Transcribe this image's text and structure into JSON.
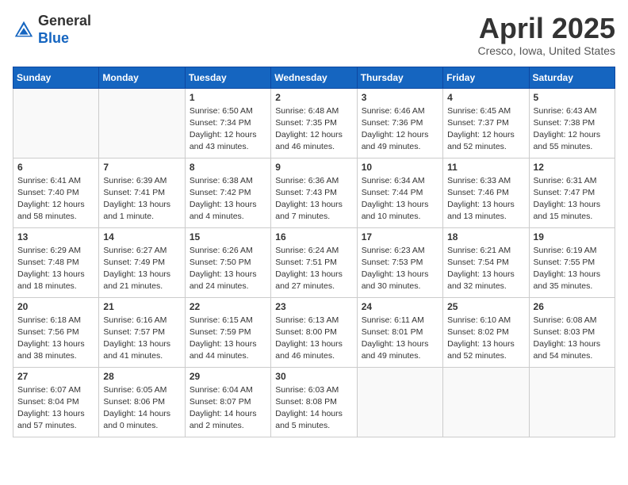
{
  "header": {
    "logo_line1": "General",
    "logo_line2": "Blue",
    "month_year": "April 2025",
    "location": "Cresco, Iowa, United States"
  },
  "calendar": {
    "days_of_week": [
      "Sunday",
      "Monday",
      "Tuesday",
      "Wednesday",
      "Thursday",
      "Friday",
      "Saturday"
    ],
    "weeks": [
      [
        {
          "day": "",
          "info": ""
        },
        {
          "day": "",
          "info": ""
        },
        {
          "day": "1",
          "info": "Sunrise: 6:50 AM\nSunset: 7:34 PM\nDaylight: 12 hours and 43 minutes."
        },
        {
          "day": "2",
          "info": "Sunrise: 6:48 AM\nSunset: 7:35 PM\nDaylight: 12 hours and 46 minutes."
        },
        {
          "day": "3",
          "info": "Sunrise: 6:46 AM\nSunset: 7:36 PM\nDaylight: 12 hours and 49 minutes."
        },
        {
          "day": "4",
          "info": "Sunrise: 6:45 AM\nSunset: 7:37 PM\nDaylight: 12 hours and 52 minutes."
        },
        {
          "day": "5",
          "info": "Sunrise: 6:43 AM\nSunset: 7:38 PM\nDaylight: 12 hours and 55 minutes."
        }
      ],
      [
        {
          "day": "6",
          "info": "Sunrise: 6:41 AM\nSunset: 7:40 PM\nDaylight: 12 hours and 58 minutes."
        },
        {
          "day": "7",
          "info": "Sunrise: 6:39 AM\nSunset: 7:41 PM\nDaylight: 13 hours and 1 minute."
        },
        {
          "day": "8",
          "info": "Sunrise: 6:38 AM\nSunset: 7:42 PM\nDaylight: 13 hours and 4 minutes."
        },
        {
          "day": "9",
          "info": "Sunrise: 6:36 AM\nSunset: 7:43 PM\nDaylight: 13 hours and 7 minutes."
        },
        {
          "day": "10",
          "info": "Sunrise: 6:34 AM\nSunset: 7:44 PM\nDaylight: 13 hours and 10 minutes."
        },
        {
          "day": "11",
          "info": "Sunrise: 6:33 AM\nSunset: 7:46 PM\nDaylight: 13 hours and 13 minutes."
        },
        {
          "day": "12",
          "info": "Sunrise: 6:31 AM\nSunset: 7:47 PM\nDaylight: 13 hours and 15 minutes."
        }
      ],
      [
        {
          "day": "13",
          "info": "Sunrise: 6:29 AM\nSunset: 7:48 PM\nDaylight: 13 hours and 18 minutes."
        },
        {
          "day": "14",
          "info": "Sunrise: 6:27 AM\nSunset: 7:49 PM\nDaylight: 13 hours and 21 minutes."
        },
        {
          "day": "15",
          "info": "Sunrise: 6:26 AM\nSunset: 7:50 PM\nDaylight: 13 hours and 24 minutes."
        },
        {
          "day": "16",
          "info": "Sunrise: 6:24 AM\nSunset: 7:51 PM\nDaylight: 13 hours and 27 minutes."
        },
        {
          "day": "17",
          "info": "Sunrise: 6:23 AM\nSunset: 7:53 PM\nDaylight: 13 hours and 30 minutes."
        },
        {
          "day": "18",
          "info": "Sunrise: 6:21 AM\nSunset: 7:54 PM\nDaylight: 13 hours and 32 minutes."
        },
        {
          "day": "19",
          "info": "Sunrise: 6:19 AM\nSunset: 7:55 PM\nDaylight: 13 hours and 35 minutes."
        }
      ],
      [
        {
          "day": "20",
          "info": "Sunrise: 6:18 AM\nSunset: 7:56 PM\nDaylight: 13 hours and 38 minutes."
        },
        {
          "day": "21",
          "info": "Sunrise: 6:16 AM\nSunset: 7:57 PM\nDaylight: 13 hours and 41 minutes."
        },
        {
          "day": "22",
          "info": "Sunrise: 6:15 AM\nSunset: 7:59 PM\nDaylight: 13 hours and 44 minutes."
        },
        {
          "day": "23",
          "info": "Sunrise: 6:13 AM\nSunset: 8:00 PM\nDaylight: 13 hours and 46 minutes."
        },
        {
          "day": "24",
          "info": "Sunrise: 6:11 AM\nSunset: 8:01 PM\nDaylight: 13 hours and 49 minutes."
        },
        {
          "day": "25",
          "info": "Sunrise: 6:10 AM\nSunset: 8:02 PM\nDaylight: 13 hours and 52 minutes."
        },
        {
          "day": "26",
          "info": "Sunrise: 6:08 AM\nSunset: 8:03 PM\nDaylight: 13 hours and 54 minutes."
        }
      ],
      [
        {
          "day": "27",
          "info": "Sunrise: 6:07 AM\nSunset: 8:04 PM\nDaylight: 13 hours and 57 minutes."
        },
        {
          "day": "28",
          "info": "Sunrise: 6:05 AM\nSunset: 8:06 PM\nDaylight: 14 hours and 0 minutes."
        },
        {
          "day": "29",
          "info": "Sunrise: 6:04 AM\nSunset: 8:07 PM\nDaylight: 14 hours and 2 minutes."
        },
        {
          "day": "30",
          "info": "Sunrise: 6:03 AM\nSunset: 8:08 PM\nDaylight: 14 hours and 5 minutes."
        },
        {
          "day": "",
          "info": ""
        },
        {
          "day": "",
          "info": ""
        },
        {
          "day": "",
          "info": ""
        }
      ]
    ]
  }
}
